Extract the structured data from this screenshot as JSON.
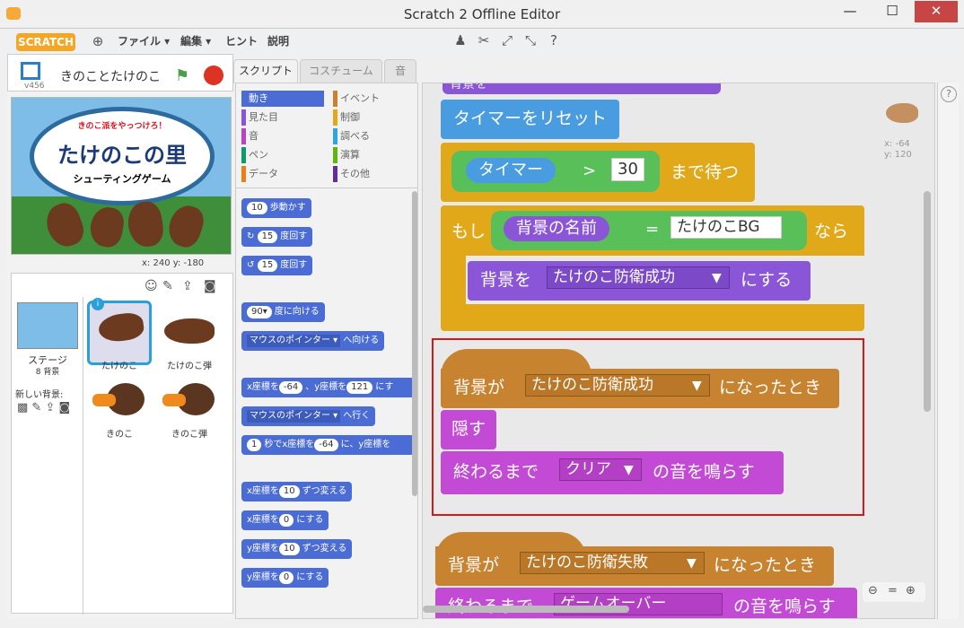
{
  "window": {
    "title": "Scratch 2 Offline Editor",
    "minimize": "—",
    "maximize": "☐",
    "close": "✕"
  },
  "menu": {
    "logo": "SCRATCH",
    "file": "ファイル ▾",
    "edit": "編集 ▾",
    "hint": "ヒント",
    "about": "説明"
  },
  "stage": {
    "project_name": "きのことたけのこ",
    "version": "v456",
    "banner_top": "きのこ派をやっつけろ！",
    "banner_title": "たけのこの里",
    "banner_sub": "シューティングゲーム",
    "coords": "x: 240  y: -180"
  },
  "sprites": {
    "stage_label": "ステージ",
    "stage_sub": "8 背景",
    "new_backdrop": "新しい背景:",
    "items": [
      {
        "label": "たけのこ"
      },
      {
        "label": "たけのこ弾"
      },
      {
        "label": "きのこ"
      },
      {
        "label": "きのこ弾"
      }
    ]
  },
  "tabs": [
    "スクリプト",
    "コスチューム",
    "音"
  ],
  "categories": {
    "left": [
      "動き",
      "見た目",
      "音",
      "ペン",
      "データ"
    ],
    "right": [
      "イベント",
      "制御",
      "調べる",
      "演算",
      "その他"
    ],
    "colors": {
      "motion": "#4a6cd4",
      "looks": "#8a55d7",
      "sound": "#bb42c3",
      "pen": "#0e9a6c",
      "data": "#ee7d16",
      "events": "#c88330",
      "control": "#e1a91a",
      "sensing": "#2ca5e2",
      "operators": "#5cb712",
      "more": "#632d99"
    }
  },
  "palette": {
    "move": {
      "v": "10",
      "t": "歩動かす"
    },
    "turn_right": {
      "v": "15",
      "t": "度回す"
    },
    "turn_left": {
      "v": "15",
      "t": "度回す"
    },
    "point_dir": {
      "v": "90▾",
      "t": "度に向ける"
    },
    "point_to": {
      "d": "マウスのポインター ▾",
      "t": "へ向ける"
    },
    "goto_xy": {
      "a": "x座標を",
      "x": "-64",
      "b": "、y座標を",
      "y": "121",
      "c": "にす"
    },
    "goto": {
      "d": "マウスのポインター ▾",
      "t": "へ行く"
    },
    "glide": {
      "v": "1",
      "a": "秒でx座標を",
      "x": "-64",
      "b": "に、y座標を"
    },
    "change_x": {
      "a": "x座標を",
      "v": "10",
      "b": "ずつ変える"
    },
    "set_x": {
      "a": "x座標を",
      "v": "0",
      "b": "にする"
    },
    "change_y": {
      "a": "y座標を",
      "v": "10",
      "b": "ずつ変える"
    },
    "set_y": {
      "a": "y座標を",
      "v": "0",
      "b": "にする"
    }
  },
  "scripts": {
    "top_partial": "背景を",
    "reset_timer": "タイマーをリセット",
    "wait_until": {
      "reporter": "タイマー",
      "op": ">",
      "value": "30",
      "suffix": "まで待つ"
    },
    "if_block": {
      "if": "もし",
      "reporter": "背景の名前",
      "op": "=",
      "value": "たけのこBG",
      "then": "なら"
    },
    "switch_backdrop": {
      "prefix": "背景を",
      "value": "たけのこ防衛成功",
      "suffix": "にする"
    },
    "hat1": {
      "prefix": "背景が",
      "value": "たけのこ防衛成功",
      "suffix": "になったとき"
    },
    "hide": "隠す",
    "play_sound": {
      "prefix": "終わるまで",
      "value": "クリア",
      "suffix": "の音を鳴らす"
    },
    "hat2": {
      "prefix": "背景が",
      "value": "たけのこ防衛失敗",
      "suffix": "になったとき"
    },
    "bottom_partial": "終わるまで",
    "bottom_value": "ゲームオーバー",
    "bottom_suffix": "の音を鳴らす",
    "sprite_info": {
      "x": "x: -64",
      "y": "y: 120"
    }
  }
}
